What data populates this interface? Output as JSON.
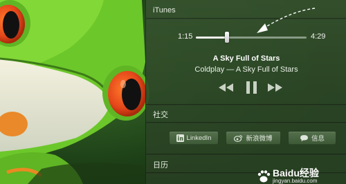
{
  "notification_center": {
    "itunes": {
      "section_title": "iTunes",
      "elapsed": "1:15",
      "duration": "4:29",
      "progress": 0.28,
      "track_title": "A Sky Full of Stars",
      "track_subtitle": "Coldplay — A Sky Full of Stars",
      "controls": [
        "rewind-icon",
        "pause-icon",
        "fast-forward-icon"
      ]
    },
    "social": {
      "section_title": "社交",
      "buttons": [
        {
          "label": "LinkedIn",
          "icon": "linkedin-icon"
        },
        {
          "label": "新浪微博",
          "icon": "weibo-icon"
        },
        {
          "label": "信息",
          "icon": "message-icon"
        }
      ]
    },
    "calendar": {
      "section_title": "日历"
    }
  },
  "watermark": {
    "text": "Baidu经验",
    "url": "jingyan.baidu.com"
  },
  "colors": {
    "panel": "#385430",
    "frog_green": "#6cc72a",
    "frog_eye": "#e8521a"
  }
}
